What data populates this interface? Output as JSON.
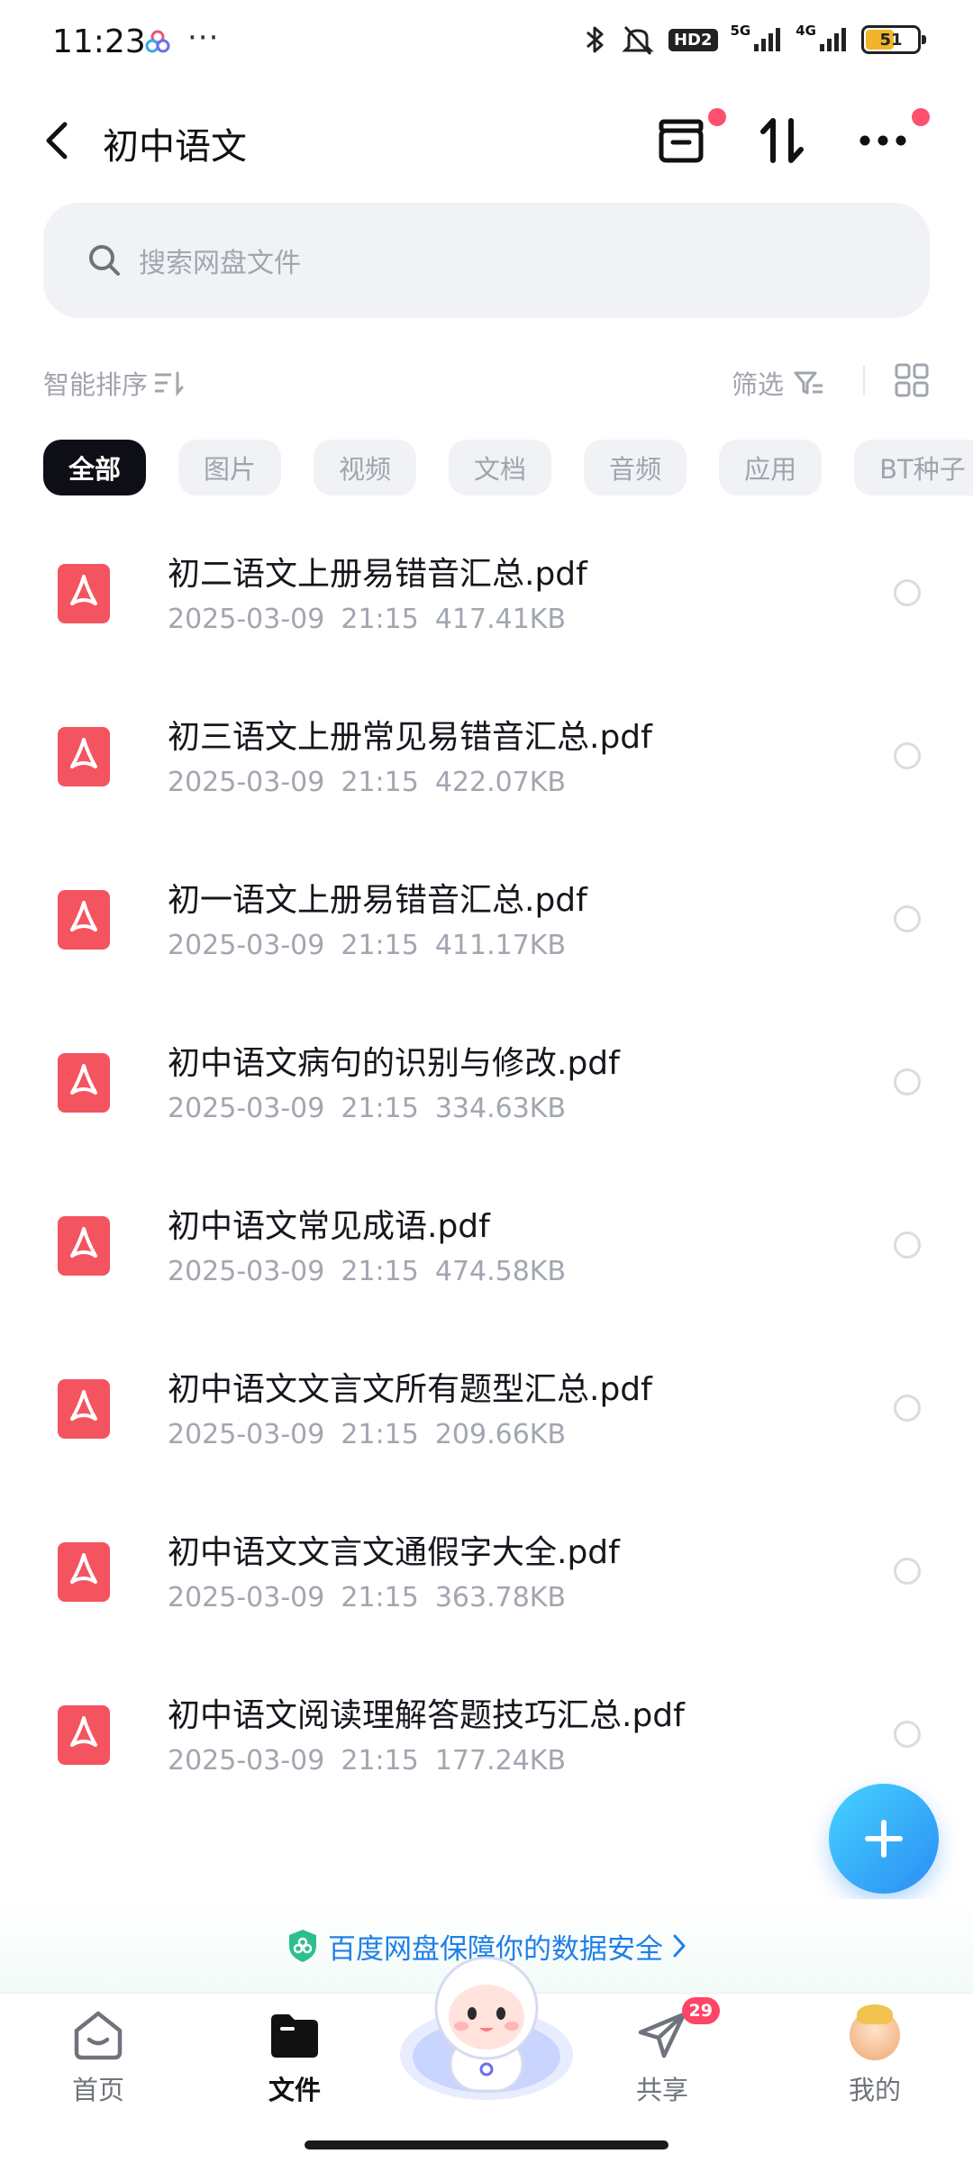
{
  "status_bar": {
    "time": "11:23",
    "dots": "···",
    "hd_label": "HD2",
    "net1": "5G",
    "net2": "4G",
    "battery": "51"
  },
  "header": {
    "title": "初中语文"
  },
  "search": {
    "placeholder": "搜索网盘文件"
  },
  "sort": {
    "sort_label": "智能排序",
    "filter_label": "筛选"
  },
  "categories": [
    {
      "label": "全部",
      "active": true
    },
    {
      "label": "图片"
    },
    {
      "label": "视频"
    },
    {
      "label": "文档"
    },
    {
      "label": "音频"
    },
    {
      "label": "应用"
    },
    {
      "label": "BT种子"
    }
  ],
  "files": [
    {
      "name": "初二语文上册易错音汇总.pdf",
      "date": "2025-03-09",
      "time": "21:15",
      "size": "417.41KB"
    },
    {
      "name": "初三语文上册常见易错音汇总.pdf",
      "date": "2025-03-09",
      "time": "21:15",
      "size": "422.07KB"
    },
    {
      "name": "初一语文上册易错音汇总.pdf",
      "date": "2025-03-09",
      "time": "21:15",
      "size": "411.17KB"
    },
    {
      "name": "初中语文病句的识别与修改.pdf",
      "date": "2025-03-09",
      "time": "21:15",
      "size": "334.63KB"
    },
    {
      "name": "初中语文常见成语.pdf",
      "date": "2025-03-09",
      "time": "21:15",
      "size": "474.58KB"
    },
    {
      "name": "初中语文文言文所有题型汇总.pdf",
      "date": "2025-03-09",
      "time": "21:15",
      "size": "209.66KB"
    },
    {
      "name": "初中语文文言文通假字大全.pdf",
      "date": "2025-03-09",
      "time": "21:15",
      "size": "363.78KB"
    },
    {
      "name": "初中语文阅读理解答题技巧汇总.pdf",
      "date": "2025-03-09",
      "time": "21:15",
      "size": "177.24KB"
    }
  ],
  "banner": {
    "text": "百度网盘保障你的数据安全"
  },
  "nav": {
    "home": "首页",
    "files": "文件",
    "share": "共享",
    "share_badge": "29",
    "me": "我的"
  },
  "colors": {
    "accent": "#2b8df5",
    "pdf_red": "#f4545f",
    "badge": "#ff4466"
  }
}
